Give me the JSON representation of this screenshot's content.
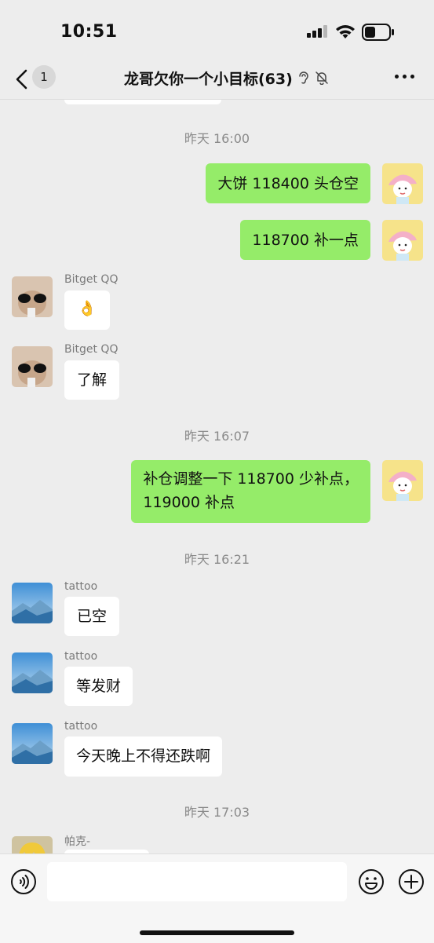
{
  "status_bar": {
    "time": "10:51",
    "battery_level": 0.4
  },
  "nav": {
    "unread_count": "1",
    "title": "龙哥欠你一个小目标(63)",
    "icons": [
      "back-chevron-icon",
      "ear-icon",
      "mute-bell-icon",
      "more-dots-icon"
    ]
  },
  "messages": [
    {
      "type": "time",
      "text": "昨天 16:00"
    },
    {
      "type": "msg",
      "side": "me",
      "avatar": "pink-hat-cartoon-avatar",
      "text": "大饼 118400 头仓空"
    },
    {
      "type": "msg",
      "side": "me",
      "avatar": "pink-hat-cartoon-avatar",
      "text": "118700 补一点"
    },
    {
      "type": "msg",
      "side": "them",
      "sender": "Bitget QQ",
      "avatar": "sunglasses-avatar",
      "text": "👌"
    },
    {
      "type": "msg",
      "side": "them",
      "sender": "Bitget QQ",
      "avatar": "sunglasses-avatar",
      "text": "了解"
    },
    {
      "type": "time",
      "text": "昨天 16:07"
    },
    {
      "type": "msg",
      "side": "me",
      "avatar": "pink-hat-cartoon-avatar",
      "lines": [
        "补仓调整一下 118700 少补点，",
        "119000 补点"
      ]
    },
    {
      "type": "time",
      "text": "昨天 16:21"
    },
    {
      "type": "msg",
      "side": "them",
      "sender": "tattoo",
      "avatar": "mountain-avatar",
      "text": "已空"
    },
    {
      "type": "msg",
      "side": "them",
      "sender": "tattoo",
      "avatar": "mountain-avatar",
      "text": "等发财"
    },
    {
      "type": "msg",
      "side": "them",
      "sender": "tattoo",
      "avatar": "mountain-avatar",
      "text": "今天晚上不得还跌啊"
    },
    {
      "type": "time",
      "text": "昨天 17:03"
    },
    {
      "type": "msg",
      "side": "them",
      "sender": "帕克-",
      "avatar": "blonde-anime-avatar",
      "text": ""
    }
  ],
  "input_bar": {
    "value": "",
    "icons": [
      "voice-icon",
      "emoji-icon",
      "plus-icon"
    ]
  },
  "colors": {
    "my_bubble": "#95ec69",
    "their_bubble": "#ffffff",
    "background": "#ededed"
  }
}
